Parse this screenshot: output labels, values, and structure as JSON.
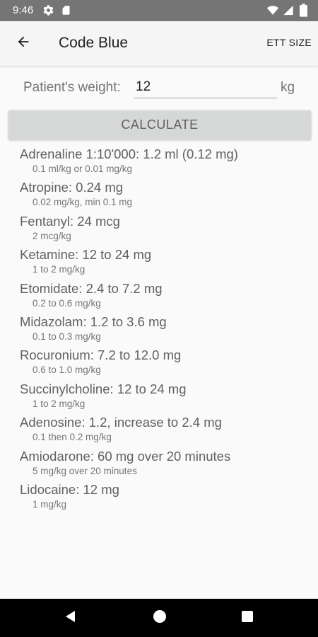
{
  "status_bar": {
    "time": "9:46",
    "icons": [
      "gear-icon",
      "sd-card-icon",
      "wifi-icon",
      "signal-icon",
      "battery-icon"
    ]
  },
  "app_bar": {
    "title": "Code Blue",
    "back_icon": "arrow-left-icon",
    "action_label": "ETT SIZE"
  },
  "weight": {
    "label": "Patient's weight:",
    "value": "12",
    "unit": "kg"
  },
  "calculate_label": "CALCULATE",
  "drugs": [
    {
      "main": "Adrenaline 1:10'000: 1.2 ml (0.12 mg)",
      "sub": "0.1 ml/kg or 0.01 mg/kg"
    },
    {
      "main": "Atropine: 0.24 mg",
      "sub": "0.02 mg/kg, min 0.1 mg"
    },
    {
      "main": "Fentanyl: 24 mcg",
      "sub": "2 mcg/kg"
    },
    {
      "main": "Ketamine: 12 to 24 mg",
      "sub": "1 to 2 mg/kg"
    },
    {
      "main": "Etomidate: 2.4 to 7.2 mg",
      "sub": "0.2 to 0.6 mg/kg"
    },
    {
      "main": "Midazolam: 1.2 to 3.6 mg",
      "sub": "0.1 to 0.3 mg/kg"
    },
    {
      "main": "Rocuronium: 7.2 to 12.0 mg",
      "sub": "0.6 to 1.0 mg/kg"
    },
    {
      "main": "Succinylcholine: 12 to 24 mg",
      "sub": "1 to 2 mg/kg"
    },
    {
      "main": "Adenosine: 1.2, increase to 2.4 mg",
      "sub": "0.1 then 0.2 mg/kg"
    },
    {
      "main": "Amiodarone: 60 mg over 20 minutes",
      "sub": "5 mg/kg over 20 minutes"
    },
    {
      "main": "Lidocaine: 12 mg",
      "sub": "1 mg/kg"
    }
  ],
  "nav_bar": {
    "icons": [
      "back-triangle-icon",
      "home-circle-icon",
      "recents-square-icon"
    ]
  },
  "colors": {
    "status_bar": "#757575",
    "app_bar": "#f5f5f5",
    "button": "#d6d7d7",
    "nav_bar": "#000000"
  }
}
